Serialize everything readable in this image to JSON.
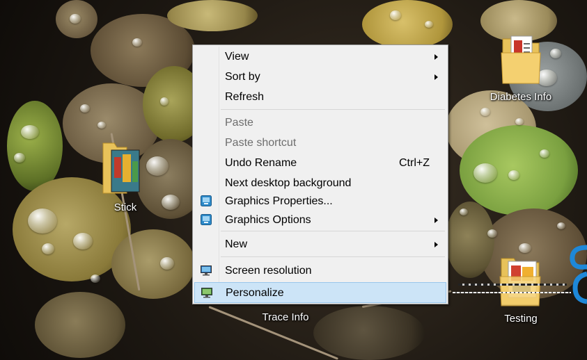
{
  "desktop": {
    "icons": [
      {
        "label": "Diabetes Info"
      },
      {
        "label": "Stick"
      },
      {
        "label": "Trace Info"
      },
      {
        "label": "Testing"
      }
    ]
  },
  "context_menu": {
    "items": [
      {
        "label": "View",
        "submenu": true,
        "disabled": false
      },
      {
        "label": "Sort by",
        "submenu": true,
        "disabled": false
      },
      {
        "label": "Refresh",
        "submenu": false,
        "disabled": false
      },
      {
        "label": "Paste",
        "submenu": false,
        "disabled": true
      },
      {
        "label": "Paste shortcut",
        "submenu": false,
        "disabled": true
      },
      {
        "label": "Undo Rename",
        "shortcut": "Ctrl+Z",
        "submenu": false,
        "disabled": false
      },
      {
        "label": "Next desktop background",
        "submenu": false,
        "disabled": false
      },
      {
        "label": "Graphics Properties...",
        "icon": "intel-graphics-icon",
        "submenu": false,
        "disabled": false
      },
      {
        "label": "Graphics Options",
        "icon": "intel-graphics-icon",
        "submenu": true,
        "disabled": false
      },
      {
        "label": "New",
        "submenu": true,
        "disabled": false
      },
      {
        "label": "Screen resolution",
        "icon": "monitor-icon",
        "submenu": false,
        "disabled": false
      },
      {
        "label": "Personalize",
        "icon": "personalize-icon",
        "submenu": false,
        "disabled": false,
        "highlighted": true
      }
    ]
  },
  "colors": {
    "menu_bg": "#f0f0f0",
    "highlight_bg": "#cce4f7",
    "highlight_border": "#98c6eb",
    "disabled_text": "#6d6d6d"
  }
}
